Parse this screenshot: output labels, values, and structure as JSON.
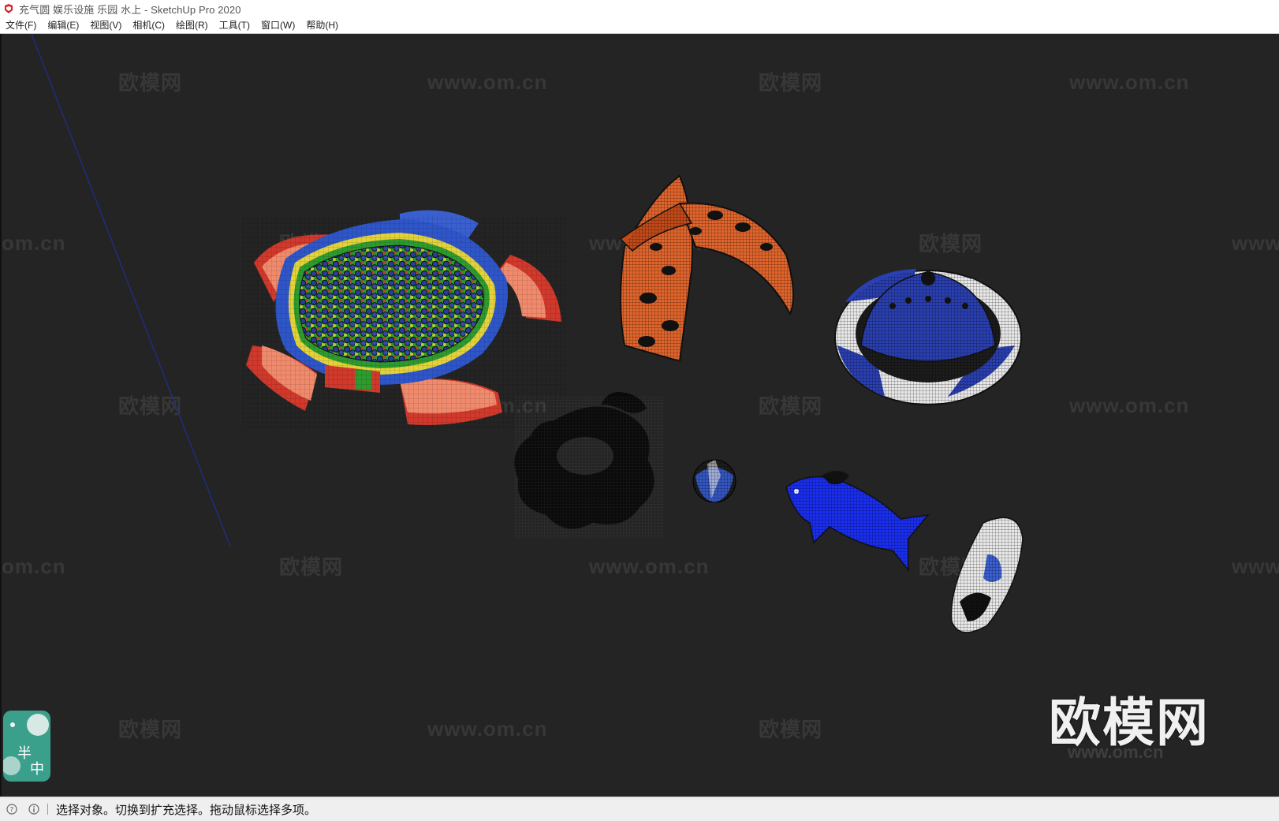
{
  "window": {
    "title": "充气圆 娱乐设施 乐园 水上 - SketchUp Pro 2020",
    "app_icon": "sketchup-logo-icon"
  },
  "menu": {
    "items": [
      "文件(F)",
      "编辑(E)",
      "视图(V)",
      "相机(C)",
      "绘图(R)",
      "工具(T)",
      "窗口(W)",
      "帮助(H)"
    ]
  },
  "viewport": {
    "background": "#242424",
    "watermark_cn": "欧模网",
    "watermark_url": "www.om.cn",
    "watermark_url_partial": "om.cn",
    "watermark_url_left": "www.",
    "brand_text": "欧模网",
    "axis_color": "#1f2d7a",
    "models": [
      {
        "name": "ball-pit-pool",
        "colors": [
          "#2f56c8",
          "#d0392b",
          "#f08a6c",
          "#e3d23a",
          "#2f9a2f"
        ]
      },
      {
        "name": "inflatable-slide-arch",
        "colors": [
          "#e0652c",
          "#111111"
        ]
      },
      {
        "name": "inflatable-dome-ring",
        "colors": [
          "#2a3fb0",
          "#e8e8e8"
        ]
      },
      {
        "name": "flower-swim-ring",
        "colors": [
          "#0a0a0a"
        ]
      },
      {
        "name": "beach-ball",
        "colors": [
          "#3456c0",
          "#111111"
        ]
      },
      {
        "name": "dolphin-float",
        "colors": [
          "#1a2ef0",
          "#0b0b0b"
        ]
      },
      {
        "name": "surfboard",
        "colors": [
          "#e8e8e8",
          "#3a5fd0"
        ]
      }
    ]
  },
  "ime": {
    "label_top": "半",
    "label_bottom": "中",
    "icon": "ime-status-icon",
    "colors": [
      "#3aa08c",
      "#f5f5f5"
    ]
  },
  "statusbar": {
    "icons": [
      "help-circle-icon",
      "info-circle-icon"
    ],
    "message": "选择对象。切换到扩充选择。拖动鼠标选择多项。"
  }
}
